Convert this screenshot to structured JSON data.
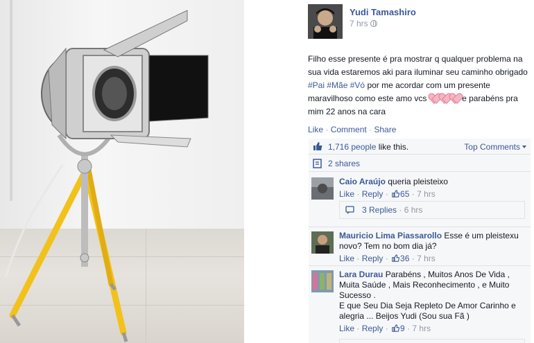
{
  "post": {
    "author": "Yudi Tamashiro",
    "time": "7 hrs",
    "caption_before": "Filho esse presente é pra mostrar q qualquer problema na sua vida estaremos aki para iluminar seu caminho obrigado ",
    "tag1": "#Pai",
    "tag2": "#Mãe",
    "tag3": "#Vó",
    "caption_mid": " por me acordar com um presente maravilhoso como este amo vcs ",
    "caption_after": " e parabéns pra mim 22 anos na cara"
  },
  "actions": {
    "like": "Like",
    "dot1": " · ",
    "comment": "Comment",
    "dot2": " · ",
    "share": "Share"
  },
  "feedback": {
    "likes_count": "1,716 people",
    "likes_suffix": " like this.",
    "top_comments": "Top Comments",
    "shares": "2 shares"
  },
  "comments": [
    {
      "name": "Caio Araújo",
      "text": " queria pleisteixo",
      "like": "Like",
      "reply": "Reply",
      "count": "65",
      "time": "7 hrs",
      "replies_label": "3 Replies",
      "replies_time": " · 6 hrs"
    },
    {
      "name": "Mauricio Lima Piassarollo",
      "text": " Esse é um pleistexu novo? Tem no bom dia já?",
      "like": "Like",
      "reply": "Reply",
      "count": "36",
      "time": "7 hrs"
    },
    {
      "name": "Lara Durau",
      "text": " Parabéns , Muitos Anos De Vida , Muita Saúde , Mais Reconhecimento , e Muito Sucesso .",
      "text2": "E que Seu Dia Seja Repleto De Amor Carinho e alegria ... Beijos Yudi (Sou sua Fã )",
      "like": "Like",
      "reply": "Reply",
      "count": "9",
      "time": "7 hrs"
    }
  ],
  "colors": {
    "link": "#3b5998",
    "meta": "#9197a3",
    "feedback_bg": "#f6f7f8",
    "lamp_leg": "#f2c21b"
  }
}
